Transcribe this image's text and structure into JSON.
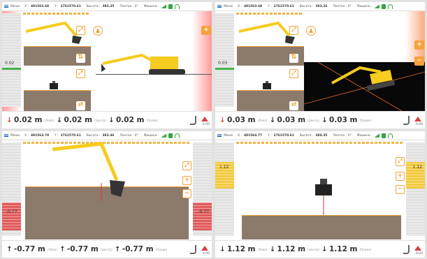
{
  "topbar": {
    "menu_label": "Меню",
    "x_label": "X :",
    "y_label": "Y :",
    "height_label": "Высота :",
    "pontoon_label": "Понтон : 0°",
    "machine_label": "Машина :"
  },
  "bottom_labels": {
    "left": "(Лево)",
    "center": "(Центр)",
    "right": "(Право)"
  },
  "bottom_zero": "0.00",
  "panels": [
    {
      "x_val": "491563.68",
      "y_val": "2761570.61",
      "height_val": "383.25",
      "level_tag": "0.02",
      "m1": "0.02 m",
      "m2": "0.02 m",
      "m3": "0.02 m"
    },
    {
      "x_val": "491563.68",
      "y_val": "2761570.61",
      "height_val": "383.26",
      "level_tag": "0.03",
      "m1": "0.03 m",
      "m2": "0.03 m",
      "m3": "0.03 m"
    },
    {
      "x_val": "491563.70",
      "y_val": "2761570.61",
      "height_val": "382.46",
      "level_tag_l": "-0.77",
      "level_tag_r": "-0.77",
      "m1": "-0.77 m",
      "m2": "-0.77 m",
      "m3": "-0.77 m"
    },
    {
      "x_val": "491564.77",
      "y_val": "2761570.61",
      "height_val": "384.35",
      "level_tag_l": "1.12",
      "level_tag_r": "1.12",
      "m1": "1.12 m",
      "m2": "1.12 m",
      "m3": "1.12 m"
    }
  ],
  "colors": {
    "accent": "#f2a33a",
    "soil": "#8c7a6b",
    "excavator": "#f5cc1f",
    "alert": "#d84040",
    "ok": "#46b04a"
  },
  "icons": [
    "menu-icon",
    "excavator-icon",
    "wifi-icon",
    "book-icon",
    "compass-icon",
    "expand-icon",
    "zoom-in-icon",
    "zoom-out-icon",
    "swap-icon",
    "bucket-icon",
    "arrow-up-icon",
    "arrow-down-icon",
    "hook-icon",
    "warning-triangle-icon"
  ]
}
